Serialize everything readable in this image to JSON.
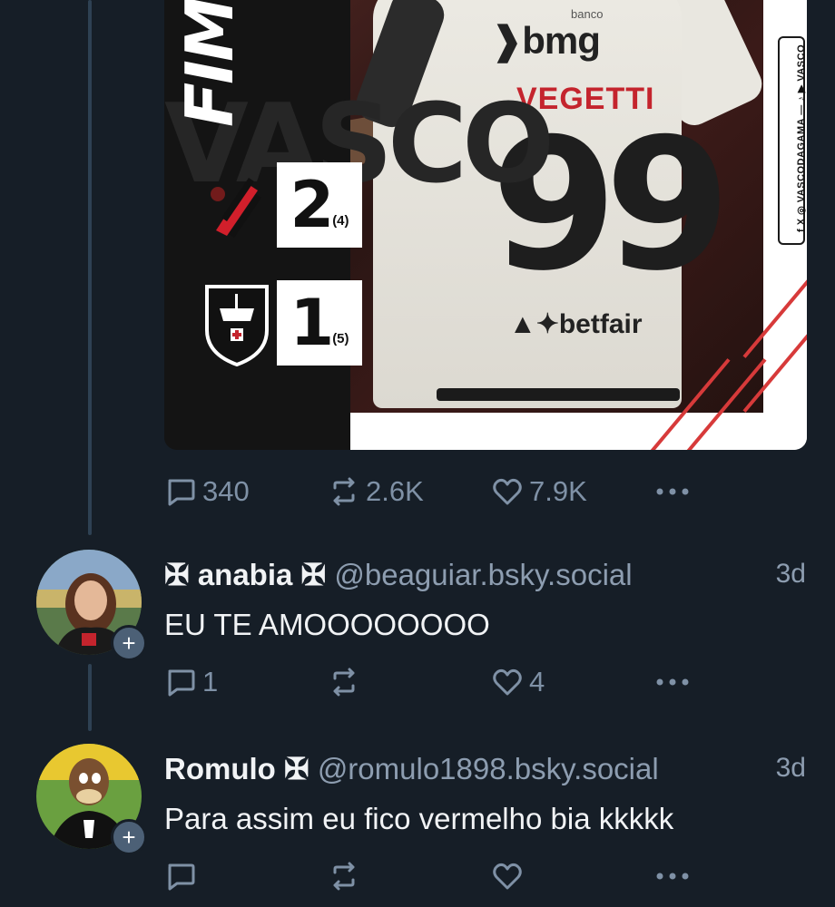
{
  "post": {
    "media": {
      "final_label": "FIM",
      "background_letters": "VASCO",
      "social_handle": "f X ◎ VASCODAGAMA — ♪ ▶ VASCO",
      "sponsor_top": "bmg",
      "sponsor_top_prefix": "banco",
      "player_name": "VEGETTI",
      "player_number": "99",
      "sponsor_bottom": "betfair",
      "home_score": "2",
      "home_penalties": "(4)",
      "away_score": "1",
      "away_penalties": "(5)"
    },
    "stats": {
      "replies": "340",
      "reposts": "2.6K",
      "likes": "7.9K"
    }
  },
  "replies": [
    {
      "display_name": "✠ anabia ✠",
      "handle": "@beaguiar.bsky.social",
      "time": "3d",
      "text": "EU TE AMOOOOOOOO",
      "reply_count": "1",
      "repost_count": "",
      "like_count": "4"
    },
    {
      "display_name": "Romulo ✠",
      "handle": "@romulo1898.bsky.social",
      "time": "3d",
      "text": "Para assim eu fico vermelho bia kkkkk",
      "reply_count": "",
      "repost_count": "",
      "like_count": ""
    }
  ],
  "colors": {
    "background": "#161e27",
    "text": "#f1f3f5",
    "muted": "#7f91a6",
    "thread_line": "#2e4153",
    "accent_red": "#c4242d"
  },
  "icons": {
    "reply": "speech-bubble-icon",
    "repost": "repost-arrows-icon",
    "like": "heart-icon",
    "more": "ellipsis-icon",
    "follow": "plus-icon"
  }
}
